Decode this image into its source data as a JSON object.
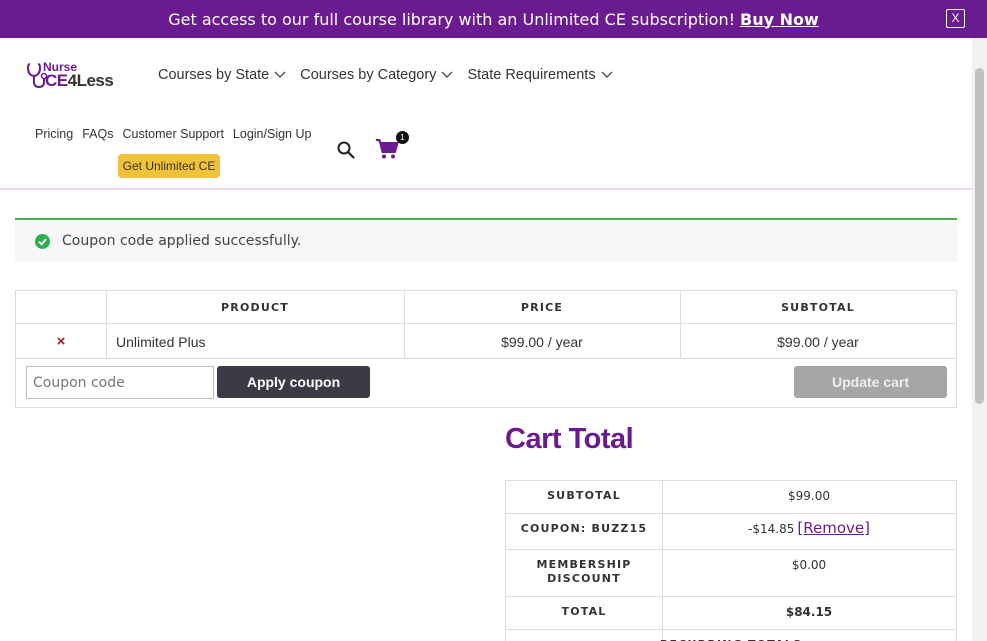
{
  "promo": {
    "text": "Get access to our full course library with an Unlimited CE subscription!",
    "link": "Buy Now",
    "close": "X"
  },
  "logo": {
    "line1": "Nurse",
    "line2a": "CE",
    "line2b": "4Less"
  },
  "nav": {
    "main": [
      "Courses by State",
      "Courses by Category",
      "State Requirements"
    ],
    "secondary": [
      "Pricing",
      "FAQs",
      "Customer Support",
      "Login/Sign Up"
    ],
    "cta": "Get Unlimited CE",
    "cart_count": "1"
  },
  "notice": {
    "text": "Coupon code applied successfully."
  },
  "cart": {
    "headers": [
      "PRODUCT",
      "PRICE",
      "SUBTOTAL"
    ],
    "rows": [
      {
        "remove": "×",
        "product": "Unlimited Plus",
        "price": "$99.00 / year",
        "subtotal": "$99.00 / year"
      }
    ],
    "coupon_placeholder": "Coupon code",
    "apply_label": "Apply coupon",
    "update_label": "Update cart"
  },
  "totals": {
    "title": "Cart Total",
    "rows": [
      {
        "label": "SUBTOTAL",
        "value": "$99.00"
      },
      {
        "label": "COUPON: BUZZ15",
        "value": "-$14.85",
        "link": "[Remove]"
      },
      {
        "label": "MEMBERSHIP DISCOUNT",
        "value": "$0.00"
      },
      {
        "label": "TOTAL",
        "value": "$84.15"
      },
      {
        "label": "RECURRING TOTALS",
        "value": ""
      }
    ]
  },
  "colors": {
    "brand": "#6a1b8f",
    "accent": "#f0c23a",
    "success": "#4caf50"
  }
}
